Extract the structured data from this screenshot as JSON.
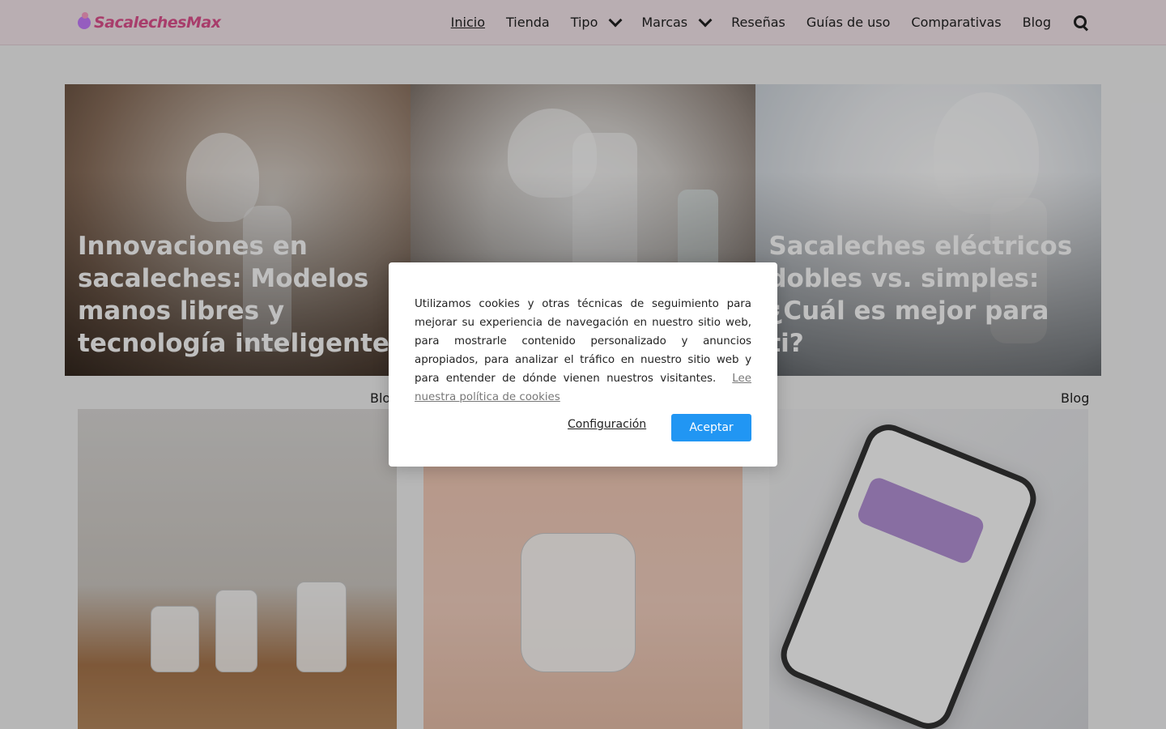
{
  "header": {
    "logo_text": "SacalechesMax",
    "nav": [
      {
        "label": "Inicio",
        "active": true
      },
      {
        "label": "Tienda"
      },
      {
        "label": "Tipo",
        "dropdown": true
      },
      {
        "label": "Marcas",
        "dropdown": true
      },
      {
        "label": "Reseñas"
      },
      {
        "label": "Guías de uso"
      },
      {
        "label": "Comparativas"
      },
      {
        "label": "Blog"
      }
    ],
    "search_icon": "search-icon"
  },
  "hero": [
    {
      "title": "Innovaciones en sacaleches: Modelos manos libres y tecnología inteligente"
    },
    {
      "title": ""
    },
    {
      "title": "Sacaleches eléctricos dobles vs. simples: ¿Cuál es mejor para ti?"
    }
  ],
  "cards": [
    {
      "category": "Blog"
    },
    {
      "category": ""
    },
    {
      "category": "Blog"
    }
  ],
  "cookie_modal": {
    "text": "Utilizamos cookies y otras técnicas de seguimiento para mejorar su experiencia de navegación en nuestro sitio web, para mostrarle contenido personalizado y anuncios apropiados, para analizar el tráfico en nuestro sitio web y para entender de dónde vienen nuestros visitantes.",
    "policy_link": "Lee nuestra política de cookies",
    "settings_label": "Configuración",
    "accept_label": "Aceptar"
  },
  "colors": {
    "header_bg": "#f7e9ee",
    "logo": "#e0528f",
    "accent": "#2196f3"
  }
}
